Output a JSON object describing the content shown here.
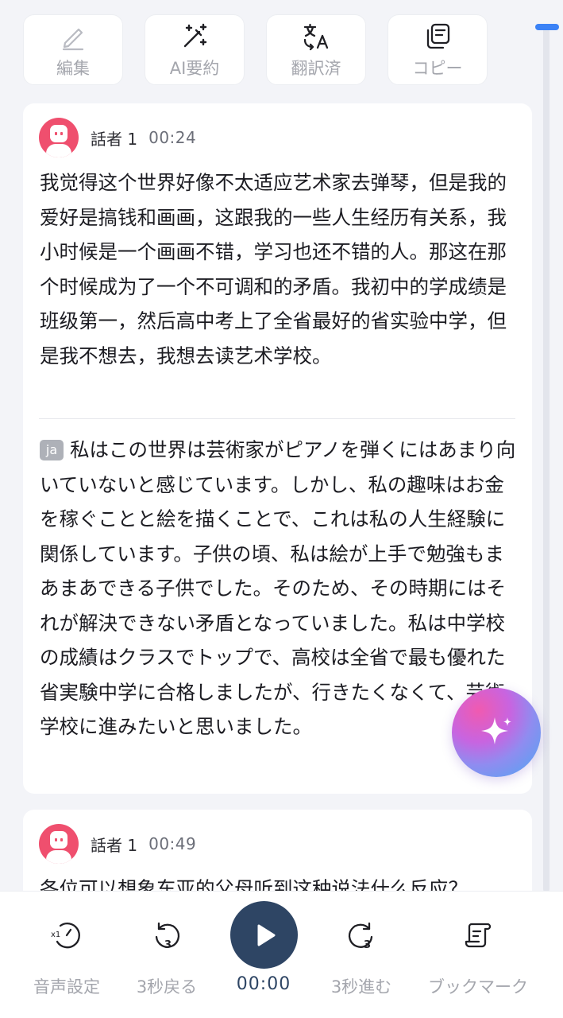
{
  "toolbar": {
    "edit_label": "編集",
    "ai_summary_label": "AI要約",
    "translated_label": "翻訳済",
    "copy_label": "コピー"
  },
  "segments": [
    {
      "speaker": "話者 1",
      "time": "00:24",
      "text_zh": "我觉得这个世界好像不太适应艺术家去弹琴，但是我的爱好是搞钱和画画，这跟我的一些人生经历有关系，我小时候是一个画画不错，学习也还不错的人。那这在那个时候成为了一个不可调和的矛盾。我初中的学成绩是班级第一，然后高中考上了全省最好的省实验中学，但是我不想去，我想去读艺术学校。",
      "lang_tag": "ja",
      "text_ja": "私はこの世界は芸術家がピアノを弾くにはあまり向いていないと感じています。しかし、私の趣味はお金を稼ぐことと絵を描くことで、これは私の人生経験に関係しています。子供の頃、私は絵が上手で勉強もまあまあできる子供でした。そのため、その時期にはそれが解決できない矛盾となっていました。私は中学校の成績はクラスでトップで、高校は全省で最も優れた省実験中学に合格しましたが、行きたくなくて、芸術学校に進みたいと思いました。"
    },
    {
      "speaker": "話者 1",
      "time": "00:49",
      "text_zh": "各位可以想象东亚的父母听到这种说法什么反应？"
    }
  ],
  "bottom_bar": {
    "audio_settings_label": "音声設定",
    "back_3s_label": "3秒戻る",
    "playback_time": "00:00",
    "forward_3s_label": "3秒進む",
    "bookmark_label": "ブックマーク"
  },
  "colors": {
    "accent": "#3b82f6",
    "play_button": "#2e4564",
    "avatar": "#ef4f6e"
  }
}
